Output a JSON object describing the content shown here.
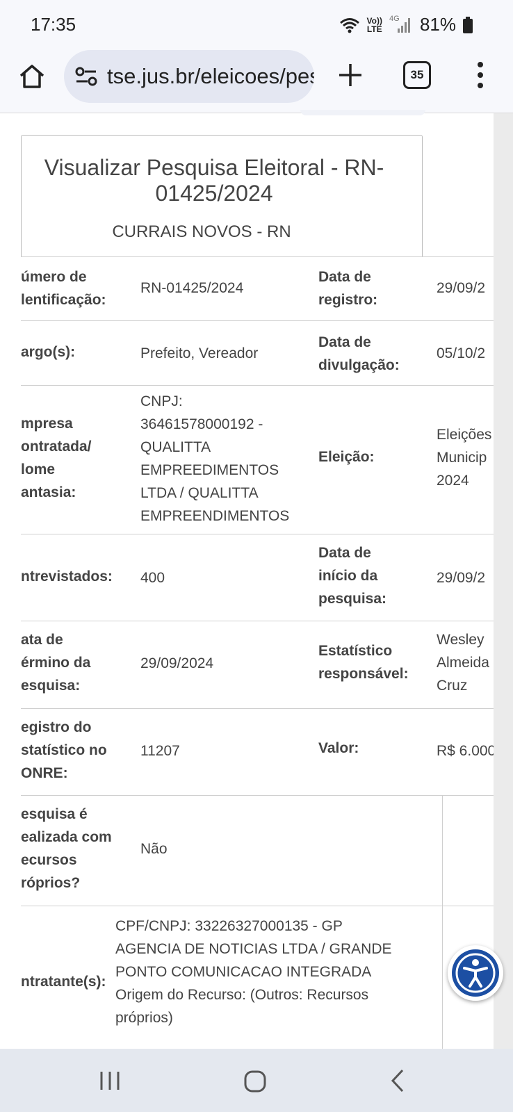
{
  "status_bar": {
    "time": "17:35",
    "volte_top": "Vo))",
    "volte_bottom": "LTE",
    "network": "4G",
    "battery": "81%"
  },
  "browser": {
    "url": "tse.jus.br/eleicoes/pesquisas",
    "tab_count": "35"
  },
  "page": {
    "title_line1": "Visualizar Pesquisa Eleitoral - RN-",
    "title_line2": "01425/2024",
    "subtitle": "CURRAIS NOVOS - RN"
  },
  "rows": [
    {
      "label": [
        "úmero de",
        "lentificação:"
      ],
      "value": [
        "RN-01425/2024"
      ],
      "label2": [
        "Data de",
        "registro:"
      ],
      "value2": [
        "29/09/2"
      ]
    },
    {
      "label": [
        "argo(s):"
      ],
      "value": [
        "Prefeito, Vereador"
      ],
      "label2": [
        "Data de",
        "divulgação:"
      ],
      "value2": [
        "05/10/2"
      ]
    },
    {
      "label": [
        "mpresa",
        "ontratada/",
        "lome",
        "antasia:"
      ],
      "value": [
        "CNPJ:",
        "36461578000192 -",
        "QUALITTA",
        "EMPREEDIMENTOS",
        "LTDA / QUALITTA",
        "EMPREENDIMENTOS"
      ],
      "label2": [
        "Eleição:"
      ],
      "value2": [
        "Eleições",
        "Municip",
        "2024"
      ]
    },
    {
      "label": [
        "ntrevistados:"
      ],
      "value": [
        "400"
      ],
      "label2": [
        "Data de",
        "início da",
        "pesquisa:"
      ],
      "value2": [
        "29/09/2"
      ]
    },
    {
      "label": [
        "ata de",
        "érmino da",
        "esquisa:"
      ],
      "value": [
        "29/09/2024"
      ],
      "label2": [
        "Estatístico",
        "responsável:"
      ],
      "value2": [
        "Wesley",
        "Almeida",
        "Cruz"
      ]
    },
    {
      "label": [
        "egistro do",
        "statístico no",
        "ONRE:"
      ],
      "value": [
        "11207"
      ],
      "label2": [
        "Valor:"
      ],
      "value2": [
        "R$ 6.000"
      ]
    },
    {
      "label": [
        "esquisa é",
        "ealizada com",
        "ecursos",
        "róprios?"
      ],
      "value": [
        "Não"
      ]
    },
    {
      "label": [
        "ntratante(s):"
      ],
      "value": [
        "CPF/CNPJ: 33226327000135 - GP",
        "AGENCIA DE NOTICIAS LTDA / GRANDE",
        "PONTO COMUNICACAO INTEGRADA",
        "Origem do Recurso: (Outros: Recursos",
        "próprios)"
      ]
    }
  ],
  "icons": {
    "home": "home-icon",
    "site_settings": "tune-icon",
    "add_tab": "plus-icon",
    "menu": "kebab-menu-icon",
    "accessibility": "accessibility-icon",
    "recents": "recents-icon",
    "home_nav": "home-nav-icon",
    "back": "back-icon"
  },
  "colors": {
    "accessibility_blue": "#1c4fa3",
    "text": "#444444",
    "border": "#cfcfcf"
  }
}
